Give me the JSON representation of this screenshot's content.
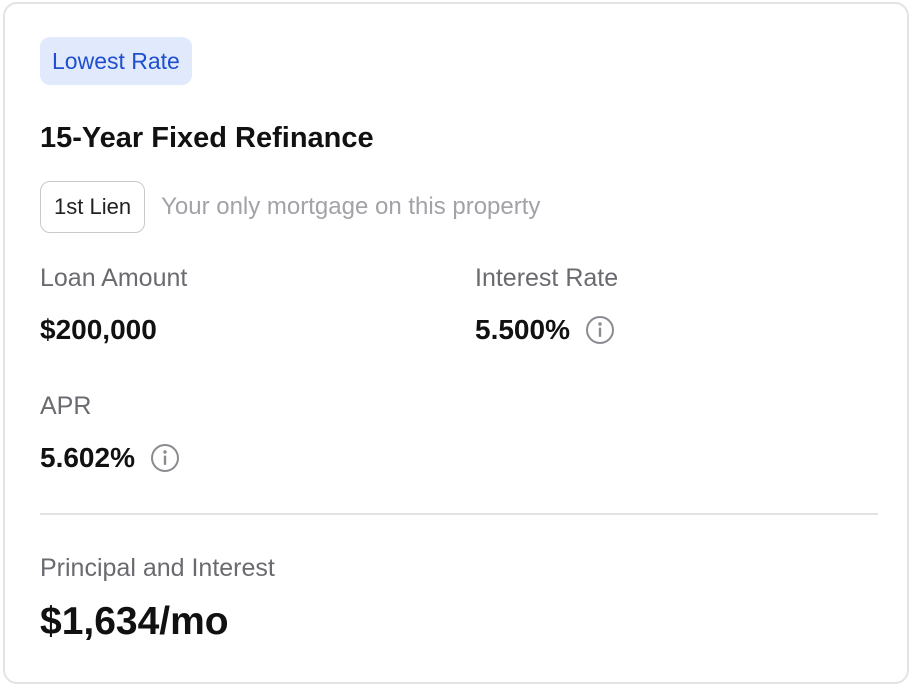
{
  "offer": {
    "badge": "Lowest Rate",
    "title": "15-Year Fixed Refinance",
    "lien": {
      "chip": "1st Lien",
      "description": "Your only mortgage on this property"
    },
    "loan_amount": {
      "label": "Loan Amount",
      "value": "$200,000"
    },
    "interest_rate": {
      "label": "Interest Rate",
      "value": "5.500%",
      "info_icon": "info-circle-icon"
    },
    "apr": {
      "label": "APR",
      "value": "5.602%",
      "info_icon": "info-circle-icon"
    },
    "payment": {
      "label": "Principal and Interest",
      "value": "$1,634/mo"
    }
  },
  "colors": {
    "badge_bg": "#e1eafc",
    "badge_text": "#1f4fcf",
    "label_text": "#6a6a70",
    "muted_text": "#a2a2a8",
    "border": "#e3e3e6"
  }
}
